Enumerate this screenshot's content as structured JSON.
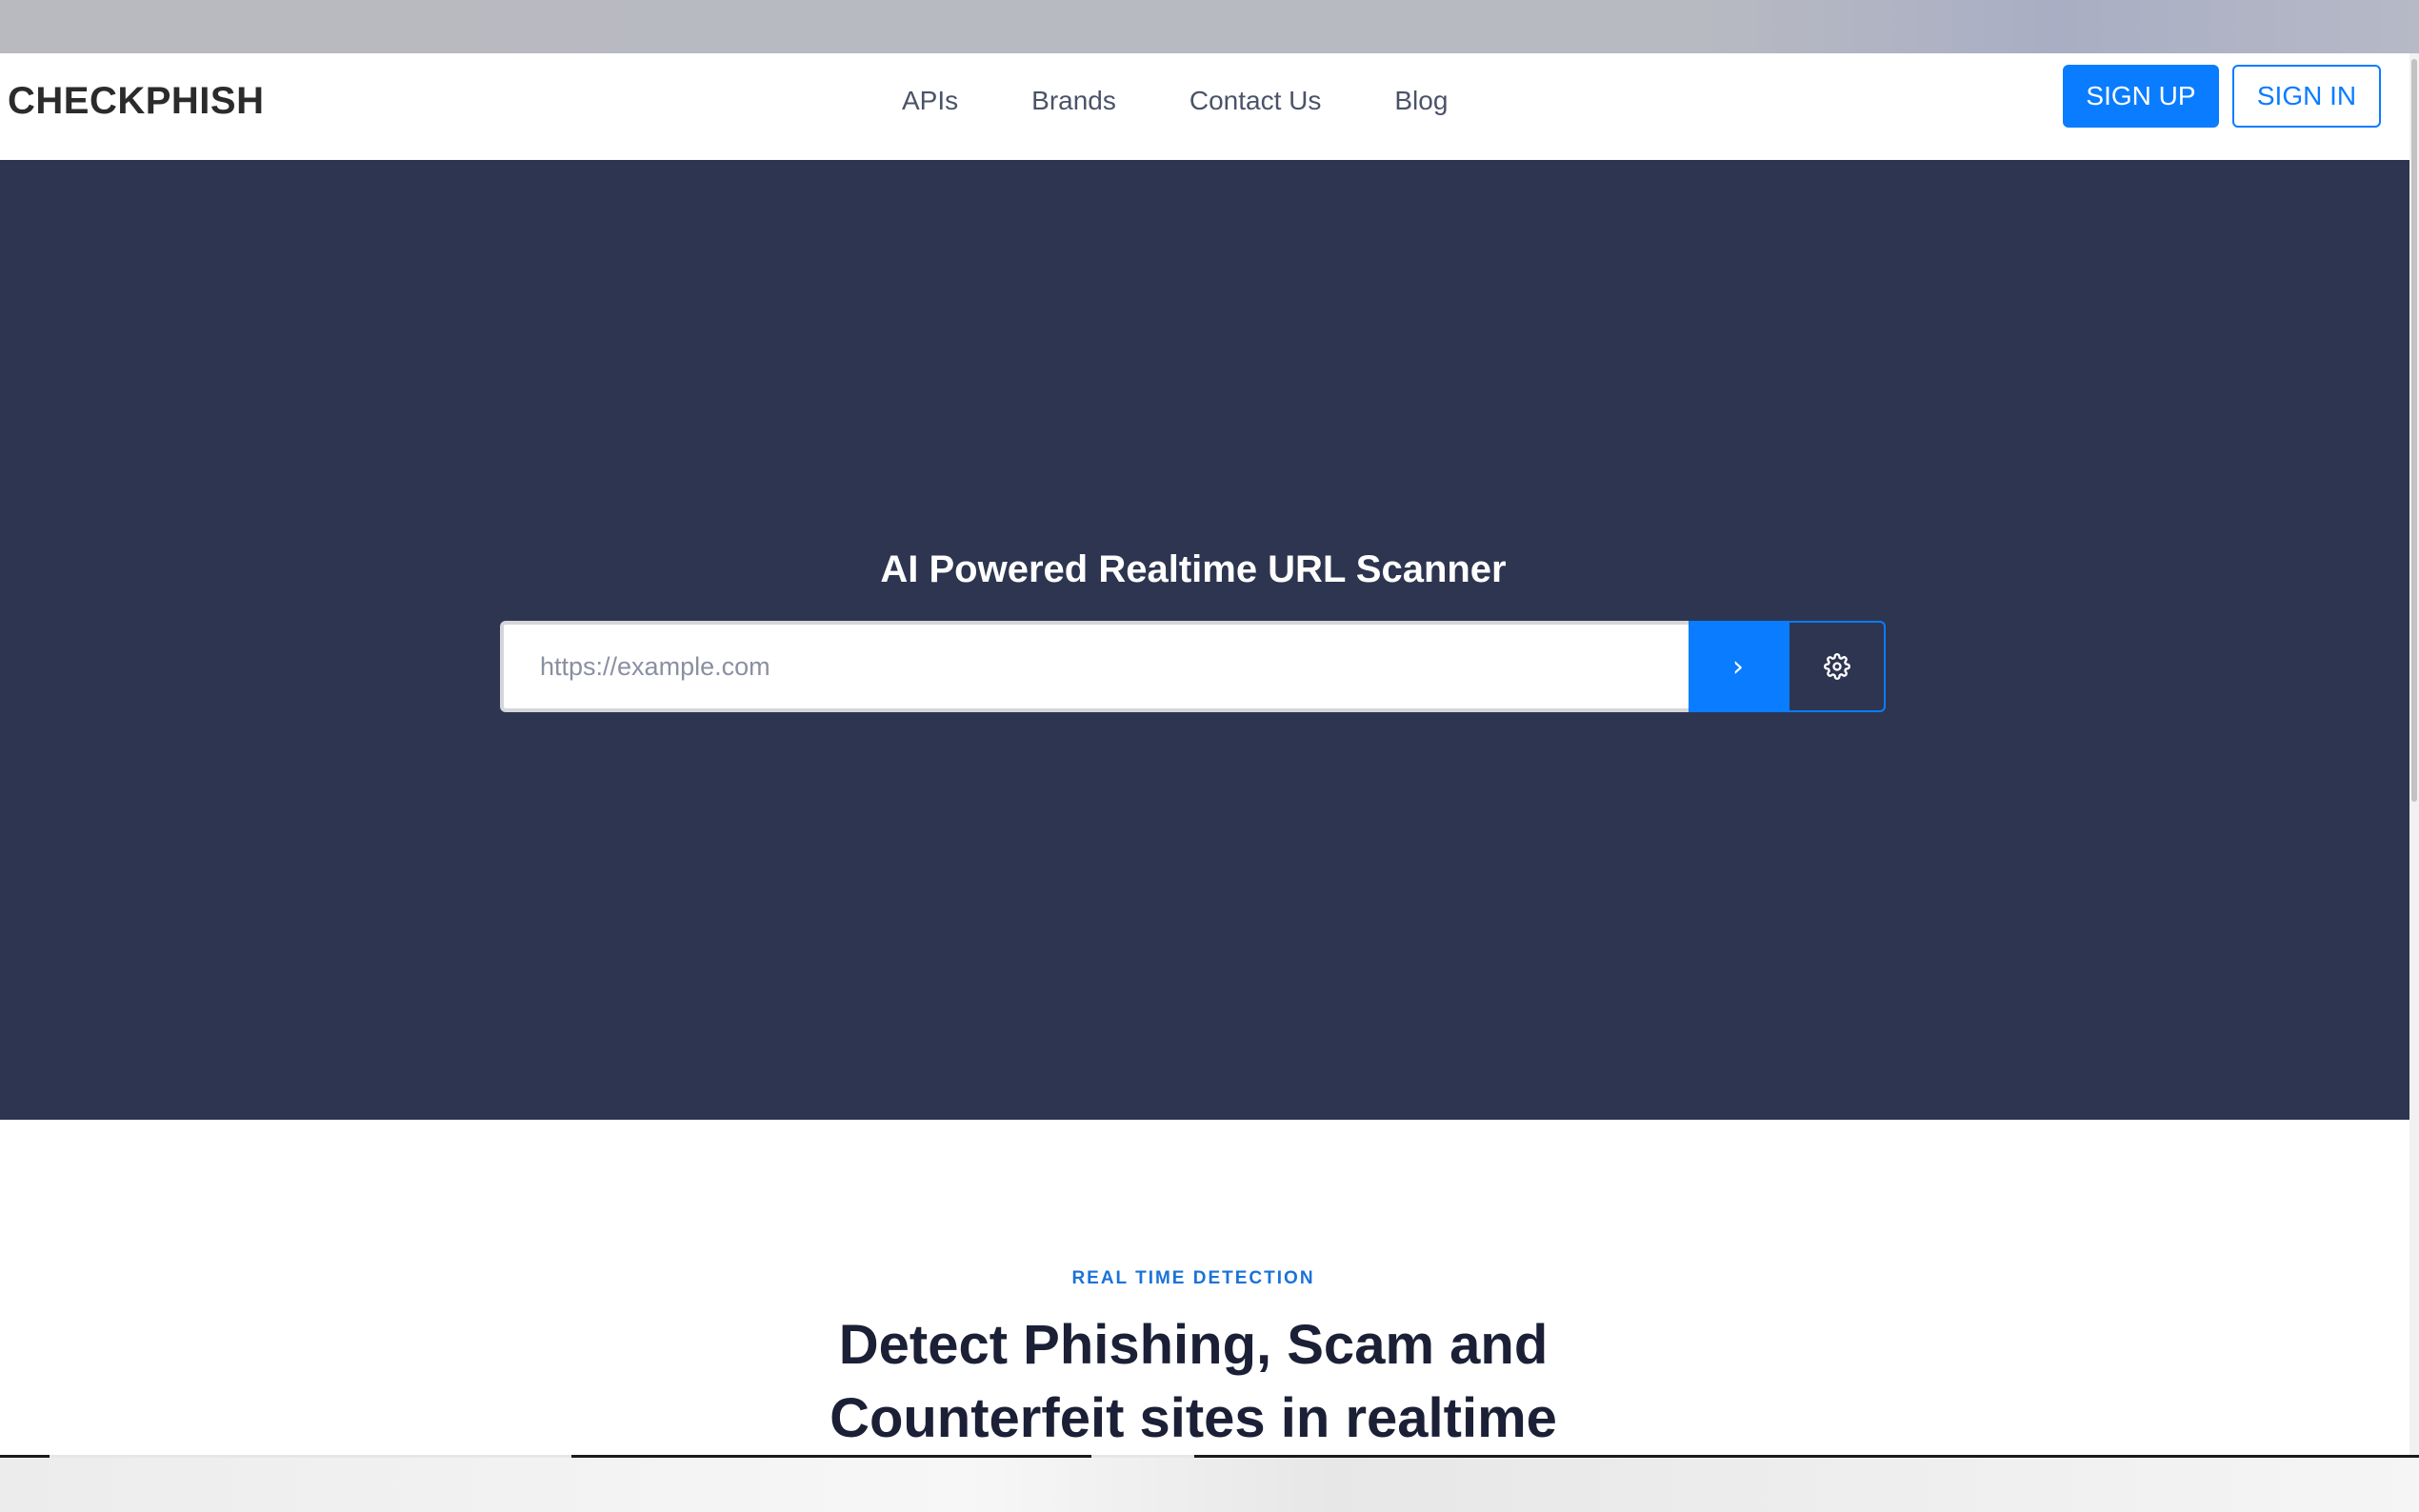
{
  "navbar": {
    "brand": "CHECKPHISH",
    "links": [
      "APIs",
      "Brands",
      "Contact Us",
      "Blog"
    ],
    "signup_label": "SIGN UP",
    "signin_label": "SIGN IN"
  },
  "hero": {
    "title": "AI Powered Realtime URL Scanner",
    "url_placeholder": "https://example.com",
    "url_value": "",
    "submit_glyph": "›",
    "settings_icon": "gear-icon"
  },
  "section": {
    "eyebrow": "REAL TIME DETECTION",
    "title_line1": "Detect Phishing, Scam and",
    "title_line2": "Counterfeit sites in realtime"
  },
  "colors": {
    "accent": "#0a7cff",
    "hero_bg": "#2d3550",
    "eyebrow": "#1a72d9",
    "heading": "#1b2036"
  }
}
